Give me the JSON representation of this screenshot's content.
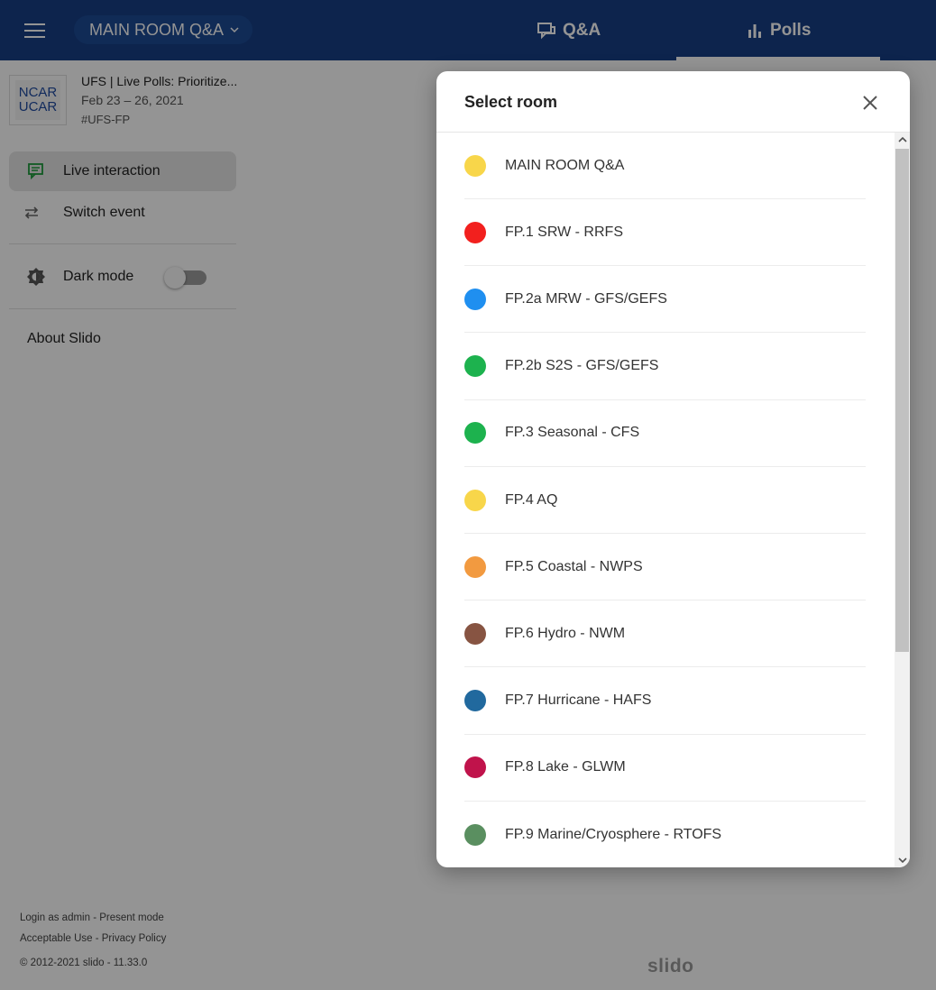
{
  "topbar": {
    "room_selector": "MAIN ROOM Q&A",
    "tabs": [
      {
        "label": "Q&A",
        "icon": "chat-bubbles-icon"
      },
      {
        "label": "Polls",
        "icon": "bar-chart-icon",
        "active": true
      }
    ]
  },
  "event": {
    "logo_text": [
      "NCAR",
      "UCAR"
    ],
    "title": "UFS | Live Polls: Prioritize...",
    "dates": "Feb 23 – 26, 2021",
    "hashtag": "#UFS-FP"
  },
  "nav": {
    "live_interaction": "Live interaction",
    "switch_event": "Switch event",
    "dark_mode": "Dark mode",
    "dark_mode_on": false,
    "about": "About Slido"
  },
  "footer": {
    "line1": "Login as admin - Present mode",
    "line2": "Acceptable Use - Privacy Policy",
    "line3": "© 2012-2021 slido - 11.33.0"
  },
  "brand": {
    "logo": "slido"
  },
  "modal": {
    "title": "Select room",
    "rooms": [
      {
        "name": "MAIN ROOM Q&A",
        "color": "#f8d64a"
      },
      {
        "name": "FP.1 SRW - RRFS",
        "color": "#f2201e"
      },
      {
        "name": "FP.2a MRW - GFS/GEFS",
        "color": "#1f8ff0"
      },
      {
        "name": "FP.2b S2S - GFS/GEFS",
        "color": "#1db24e"
      },
      {
        "name": "FP.3 Seasonal - CFS",
        "color": "#1db24e"
      },
      {
        "name": "FP.4 AQ",
        "color": "#f8d64a"
      },
      {
        "name": "FP.5 Coastal - NWPS",
        "color": "#f29a40"
      },
      {
        "name": "FP.6 Hydro - NWM",
        "color": "#875442"
      },
      {
        "name": "FP.7 Hurricane - HAFS",
        "color": "#21699e"
      },
      {
        "name": "FP.8 Lake - GLWM",
        "color": "#c0134b"
      },
      {
        "name": "FP.9 Marine/Cryosphere - RTOFS",
        "color": "#5a8f60"
      }
    ]
  }
}
